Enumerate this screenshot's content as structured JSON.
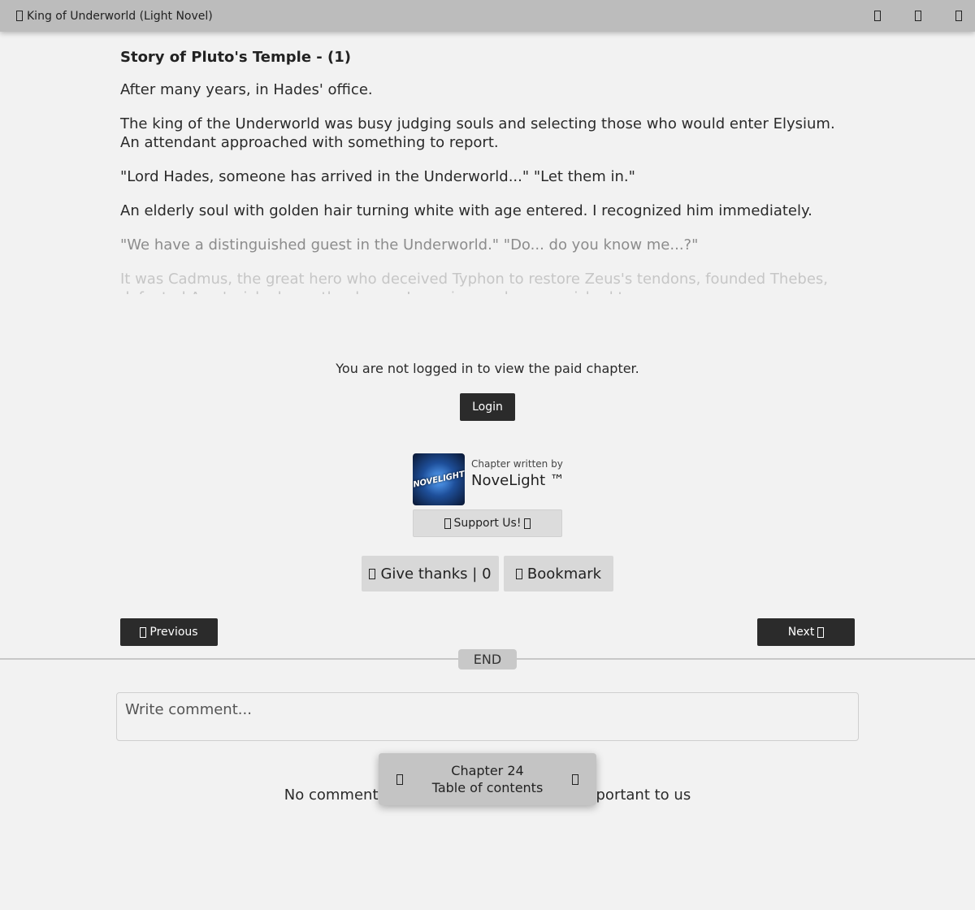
{
  "topbar": {
    "title": "King of Underworld (Light Novel)",
    "icons": [
      "book-icon",
      "settings-icon",
      "bookmark-icon",
      "menu-icon"
    ]
  },
  "chapter": {
    "title": "Story of Pluto's Temple - (1)",
    "paragraphs": [
      "After many years, in Hades' office.",
      "The king of the Underworld was busy judging souls and selecting those who would enter Elysium. An attendant approached with something to report.",
      "\"Lord Hades, someone has arrived in the Underworld...\" \"Let them in.\"",
      "An elderly soul with golden hair turning white with age entered. I recognized him immediately.",
      "\"We have a distinguished guest in the Underworld.\" \"Do... do you know me...?\"",
      "It was Cadmus, the great hero who deceived Typhon to restore Zeus's tendons, founded Thebes, defeated Ares' wicked son, the dragon Ismenios, and was punished to ..."
    ]
  },
  "paywall": {
    "notice": "You are not logged in to view the paid chapter.",
    "login_label": "Login"
  },
  "author": {
    "caption": "Chapter written by",
    "name": "NoveLight ™",
    "avatar_text": "NOVELIGHT",
    "support_label": "Support Us!"
  },
  "actions": {
    "thanks_label": "Give thanks | 0",
    "bookmark_label": "Bookmark"
  },
  "nav": {
    "previous_label": "Previous",
    "next_label": "Next"
  },
  "end_label": "END",
  "comments": {
    "placeholder": "Write comment...",
    "empty_left": "No comment",
    "empty_right": "portant to us"
  },
  "chapter_nav": {
    "chapter_label": "Chapter 24",
    "toc_label": "Table of contents"
  },
  "colors": {
    "topbar": "#bcbcbc",
    "page_bg": "#f2f2f2",
    "dark_button": "#2b2b2b",
    "gray_button": "#d8d8d8"
  }
}
